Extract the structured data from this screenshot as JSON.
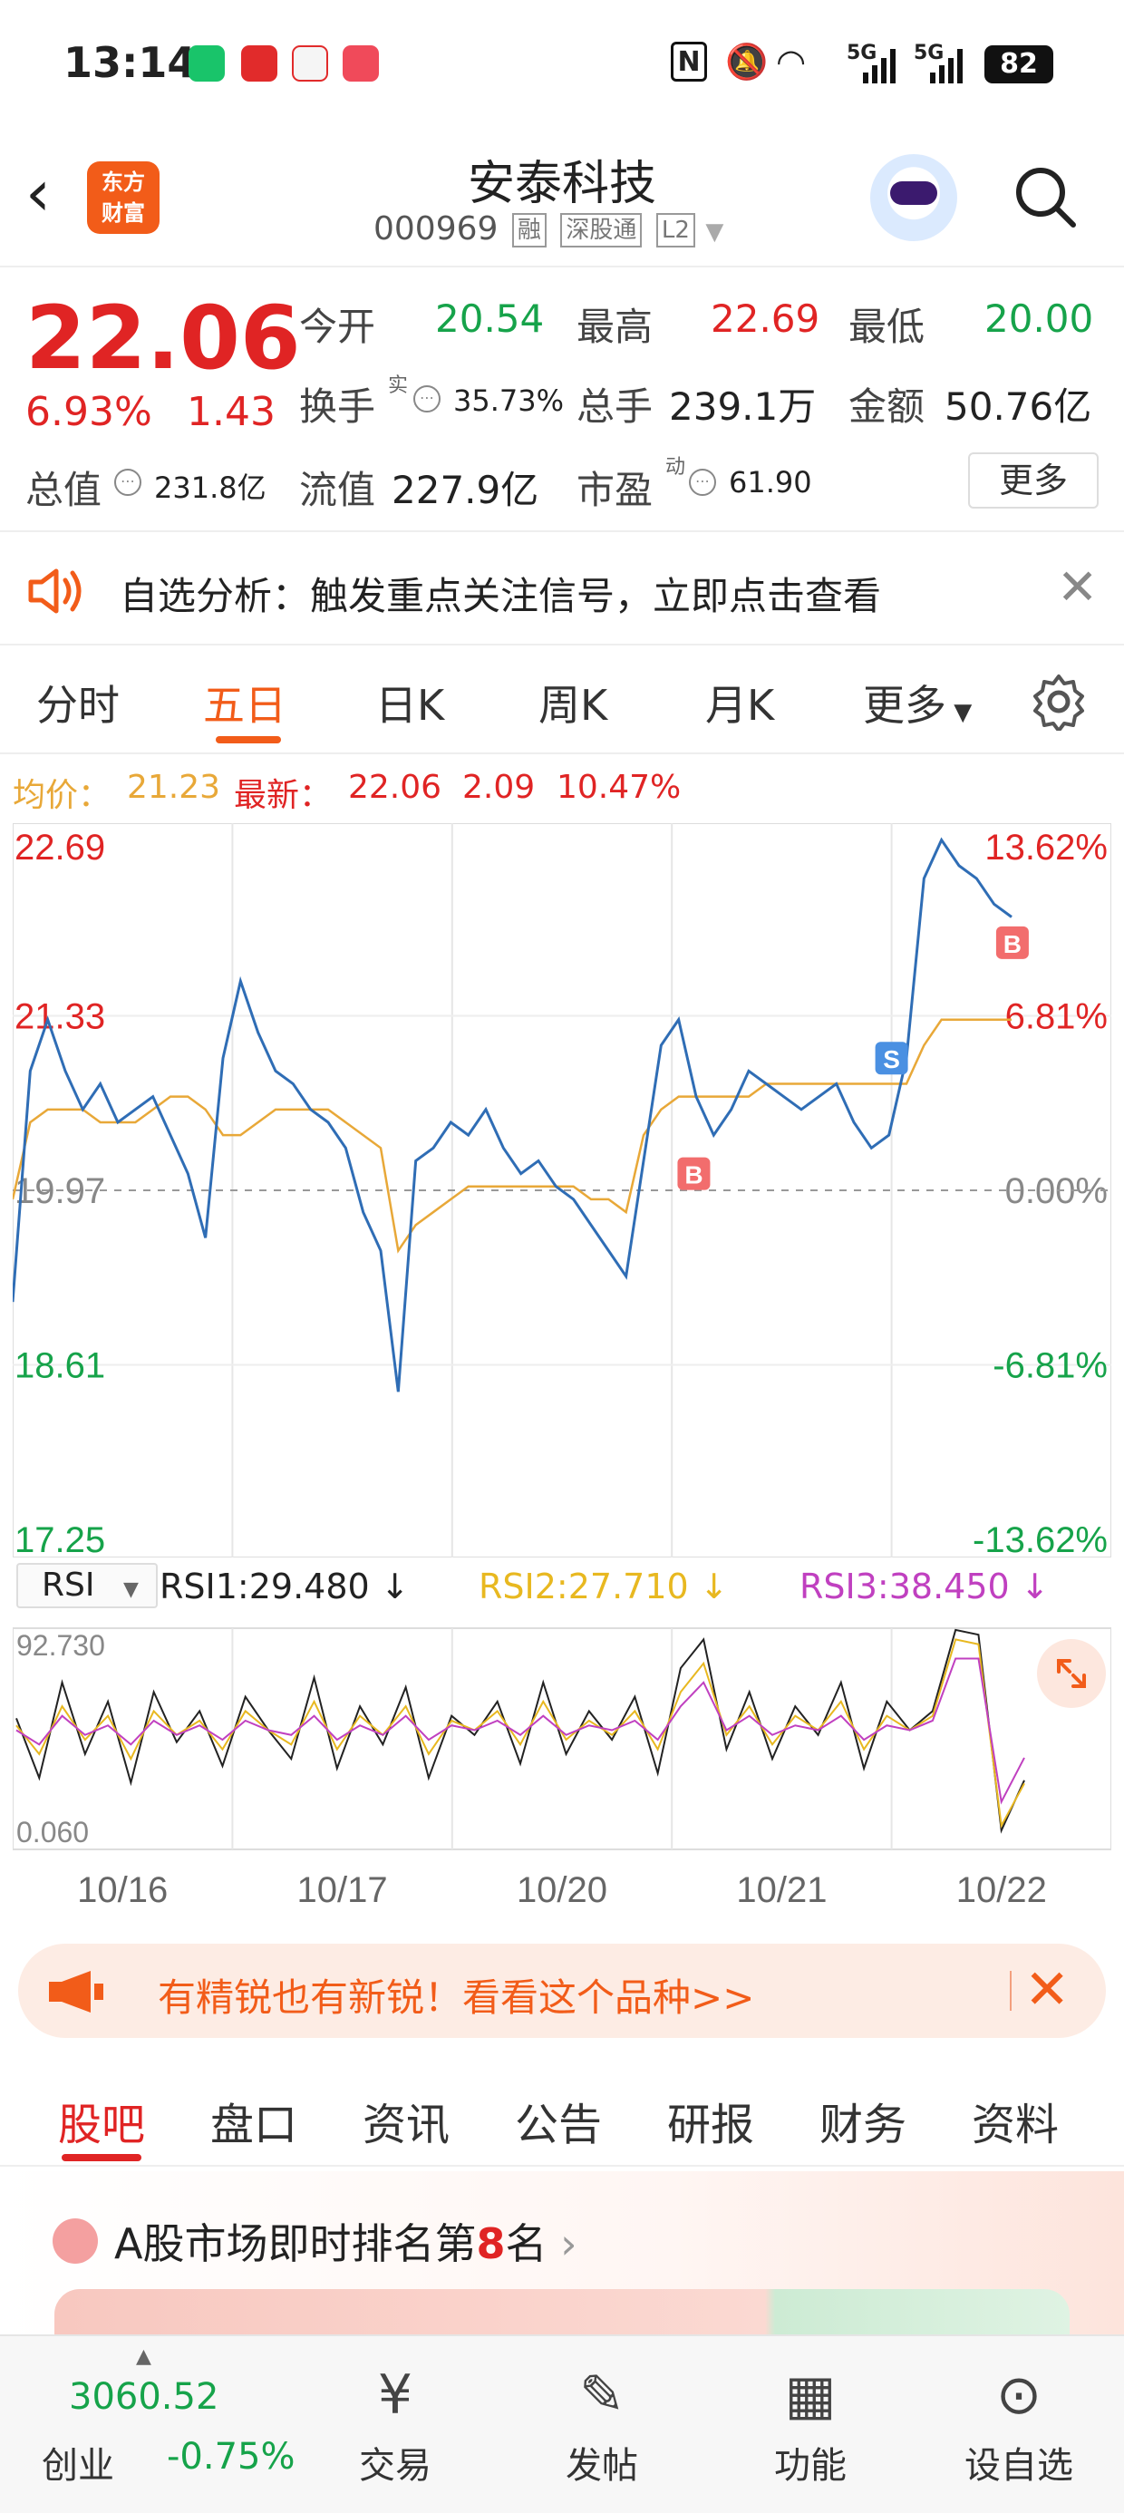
{
  "status_bar": {
    "time": "13:14",
    "nfc": "N",
    "network1": "5G",
    "network2": "5G",
    "battery": "82"
  },
  "header": {
    "back_icon": "chevron-left-icon",
    "logo_line1": "东方",
    "logo_line2": "财富",
    "stock_name": "安泰科技",
    "stock_code": "000969",
    "tags": [
      "融",
      "深股通",
      "L2"
    ]
  },
  "quote": {
    "price": "22.06",
    "change_pct": "6.93%",
    "change": "1.43",
    "open_label": "今开",
    "open": "20.54",
    "high_label": "最高",
    "high": "22.69",
    "low_label": "最低",
    "low": "20.00",
    "turnover_label": "换手",
    "turnover_sup": "实",
    "turnover": "35.73%",
    "volume_label": "总手",
    "volume": "239.1万",
    "amount_label": "金额",
    "amount": "50.76亿",
    "mktcap_label": "总值",
    "mktcap": "231.8亿",
    "float_label": "流值",
    "float_cap": "227.9亿",
    "pe_label": "市盈",
    "pe_sup": "动",
    "pe": "61.90",
    "more_button": "更多"
  },
  "alert": {
    "text": "自选分析：触发重点关注信号，立即点击查看"
  },
  "chart_tabs": [
    "分时",
    "五日",
    "日K",
    "周K",
    "月K",
    "更多"
  ],
  "chart_tabs_active": 1,
  "chart_header": {
    "avg_label": "均价：",
    "avg": "21.23",
    "latest_label": "最新：",
    "latest": "22.06",
    "change": "2.09",
    "change_pct": "10.47%"
  },
  "chart_data": [
    {
      "type": "line",
      "y_left_ticks": [
        "22.69",
        "21.33",
        "19.97",
        "18.61",
        "17.25"
      ],
      "y_right_ticks": [
        "13.62%",
        "6.81%",
        "0.00%",
        "-6.81%",
        "-13.62%"
      ],
      "x_ticks": [
        "10/16",
        "10/17",
        "10/20",
        "10/21",
        "10/22"
      ],
      "ylim": [
        17.25,
        22.69
      ],
      "reference": 19.97,
      "series": [
        {
          "color": "#2f6db5",
          "values": [
            19.1,
            20.9,
            21.3,
            20.9,
            20.6,
            20.8,
            20.5,
            20.6,
            20.7,
            20.4,
            20.1,
            19.6,
            21.0,
            21.6,
            21.2,
            20.9,
            20.8,
            20.6,
            20.5,
            20.3,
            19.8,
            19.5,
            18.4,
            20.2,
            20.3,
            20.5,
            20.4,
            20.6,
            20.3,
            20.1,
            20.2,
            20.0,
            19.9,
            19.7,
            19.5,
            19.3,
            20.2,
            21.1,
            21.3,
            20.7,
            20.4,
            20.6,
            20.9,
            20.8,
            20.7,
            20.6,
            20.7,
            20.8,
            20.5,
            20.3,
            20.4,
            21.0,
            22.4,
            22.7,
            22.5,
            22.4,
            22.2,
            22.1
          ]
        },
        {
          "color": "#e8a838",
          "values": [
            19.9,
            20.5,
            20.6,
            20.6,
            20.6,
            20.5,
            20.5,
            20.5,
            20.6,
            20.7,
            20.7,
            20.6,
            20.4,
            20.4,
            20.5,
            20.6,
            20.6,
            20.6,
            20.6,
            20.5,
            20.4,
            20.3,
            19.5,
            19.7,
            19.8,
            19.9,
            20.0,
            20.0,
            20.0,
            20.0,
            20.0,
            20.0,
            20.0,
            19.9,
            19.9,
            19.8,
            20.4,
            20.6,
            20.7,
            20.7,
            20.7,
            20.7,
            20.7,
            20.8,
            20.8,
            20.8,
            20.8,
            20.8,
            20.8,
            20.8,
            20.8,
            20.8,
            21.1,
            21.3,
            21.3,
            21.3,
            21.3,
            21.3
          ]
        }
      ],
      "markers": [
        {
          "label": "B",
          "color": "#f26d6d"
        },
        {
          "label": "S",
          "color": "#4a90e2"
        },
        {
          "label": "B",
          "color": "#f26d6d"
        }
      ]
    },
    {
      "type": "line",
      "indicator": "RSI",
      "ylim": [
        0.06,
        92.73
      ],
      "y_ticks": [
        "92.730",
        "0.060"
      ],
      "series": [
        {
          "name": "RSI1:29.480",
          "color": "#222222",
          "values": [
            55,
            30,
            70,
            40,
            62,
            28,
            66,
            45,
            58,
            35,
            64,
            50,
            38,
            72,
            34,
            60,
            44,
            68,
            30,
            56,
            48,
            62,
            36,
            70,
            40,
            58,
            46,
            64,
            32,
            76,
            88,
            42,
            66,
            38,
            60,
            48,
            70,
            34,
            62,
            50,
            58,
            92,
            90,
            8,
            29
          ]
        },
        {
          "name": "RSI2:27.710",
          "color": "#e8b820",
          "values": [
            52,
            40,
            60,
            46,
            56,
            38,
            58,
            48,
            54,
            42,
            58,
            50,
            44,
            62,
            42,
            56,
            48,
            60,
            40,
            54,
            50,
            58,
            44,
            62,
            46,
            54,
            48,
            58,
            42,
            66,
            78,
            48,
            60,
            44,
            56,
            50,
            62,
            42,
            56,
            50,
            56,
            88,
            86,
            10,
            27.7
          ]
        },
        {
          "name": "RSI3:38.450",
          "color": "#c040c0",
          "values": [
            50,
            44,
            56,
            48,
            52,
            44,
            54,
            48,
            52,
            46,
            54,
            50,
            48,
            56,
            46,
            52,
            48,
            56,
            46,
            52,
            50,
            54,
            48,
            56,
            48,
            52,
            50,
            54,
            46,
            60,
            70,
            50,
            56,
            48,
            52,
            50,
            56,
            46,
            52,
            50,
            54,
            80,
            80,
            20,
            38.45
          ]
        }
      ]
    }
  ],
  "rsi_selector": "RSI",
  "promo": {
    "text": "有精锐也有新锐！看看这个品种>>"
  },
  "sub_tabs": [
    "股吧",
    "盘口",
    "资讯",
    "公告",
    "研报",
    "财务",
    "资料"
  ],
  "sub_tabs_active": 0,
  "rank": {
    "prefix": "A股市场即时排名第",
    "rank": "8",
    "suffix": "名"
  },
  "bottom_nav": {
    "index_value": "3060.52",
    "index_name": "创业",
    "index_pct": "-0.75%",
    "items": [
      "交易",
      "发帖",
      "功能",
      "设自选"
    ]
  },
  "colors": {
    "accent": "#f25c19",
    "up": "#e02424",
    "down": "#16a34a",
    "price_line": "#2f6db5",
    "avg_line": "#e8a838"
  }
}
